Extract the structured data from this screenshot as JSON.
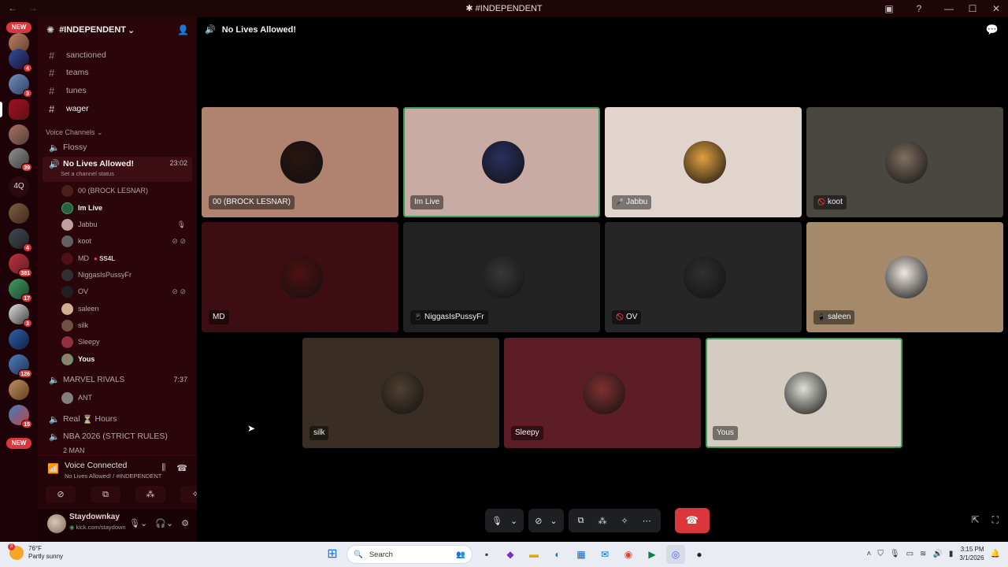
{
  "window": {
    "title": "#INDEPENDENT",
    "back": "←",
    "forward": "→"
  },
  "rail": {
    "new_top": "NEW",
    "new_bottom": "NEW",
    "badges": [
      "4",
      "3",
      "39",
      "4",
      "381",
      "17",
      "3",
      "126",
      "15"
    ],
    "text_server": "4Q"
  },
  "server": {
    "name": "#INDEPENDENT",
    "chevron": "⌄"
  },
  "channels": [
    {
      "name": "sanctioned"
    },
    {
      "name": "teams"
    },
    {
      "name": "tunes"
    },
    {
      "name": "wager"
    }
  ],
  "voice": {
    "category": "Voice Channels",
    "channels": {
      "flossy": "Flossy",
      "active": "No Lives Allowed!",
      "active_time": "23:02",
      "active_status": "Set a channel status",
      "marvel": "MARVEL RIVALS",
      "marvel_time": "7:37",
      "real": "Real",
      "real_suffix": "Hours",
      "nba": "NBA 2026 (STRICT RULES)",
      "cutoff": "2 MAN"
    },
    "members": [
      {
        "name": "00 (BROCK LESNAR)"
      },
      {
        "name": "Im Live"
      },
      {
        "name": "Jabbu"
      },
      {
        "name": "koot"
      },
      {
        "name": "MD",
        "extra": "SS4L"
      },
      {
        "name": "NiggasIsPussyFr"
      },
      {
        "name": "OV"
      },
      {
        "name": "saleen"
      },
      {
        "name": "silk"
      },
      {
        "name": "Sleepy"
      },
      {
        "name": "Yous"
      }
    ],
    "marvel_member": "ANT"
  },
  "voice_connected": {
    "title": "Voice Connected",
    "subtitle": "No Lives Allowed! / #INDEPENDENT"
  },
  "user_panel": {
    "name": "Staydownkay",
    "sub": "kick.com/staydown"
  },
  "main": {
    "channel_title": "No Lives Allowed!"
  },
  "tiles": [
    {
      "name": "00 (BROCK LESNAR)",
      "color": "#b08270",
      "icon": ""
    },
    {
      "name": "Im Live",
      "color": "#c8aba2",
      "icon": ""
    },
    {
      "name": "Jabbu",
      "color": "#e0d4cc",
      "icon": "🎤"
    },
    {
      "name": "koot",
      "color": "#4a4640",
      "icon": "🚫"
    },
    {
      "name": "MD",
      "color": "#3c0d13",
      "icon": ""
    },
    {
      "name": "NiggasIsPussyFr",
      "color": "#222222",
      "icon": "📱"
    },
    {
      "name": "OV",
      "color": "#262626",
      "icon": "🚫"
    },
    {
      "name": "saleen",
      "color": "#a48a6a",
      "icon": "📱"
    },
    {
      "name": "silk",
      "color": "#3a2e24",
      "icon": ""
    },
    {
      "name": "Sleepy",
      "color": "#5c1d27",
      "icon": ""
    },
    {
      "name": "Yous",
      "color": "#d4ccc0",
      "icon": ""
    }
  ],
  "taskbar": {
    "temp": "76°F",
    "weather": "Partly sunny",
    "weather_badge": "3",
    "search": "Search",
    "time": "3:15 PM",
    "date": "3/1/2026"
  }
}
